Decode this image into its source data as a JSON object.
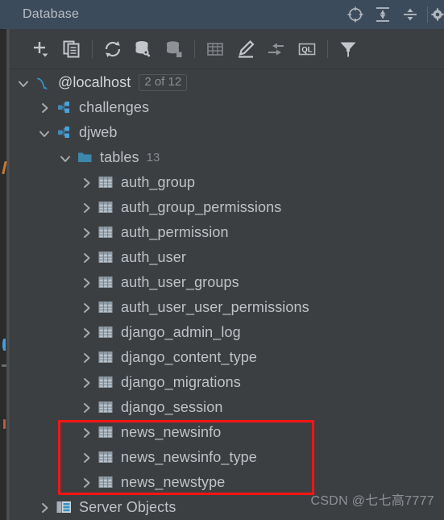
{
  "window": {
    "title": "Database"
  },
  "header": {
    "actions": [
      {
        "name": "locate-in-tree-icon",
        "label": "Scroll from Source"
      },
      {
        "name": "expand-all-icon",
        "label": "Expand All"
      },
      {
        "name": "collapse-all-icon",
        "label": "Collapse All"
      },
      {
        "name": "settings-gear-icon",
        "label": "Settings"
      }
    ]
  },
  "toolbar": {
    "buttons": [
      {
        "name": "add-new-icon",
        "label": "New"
      },
      {
        "name": "duplicate-icon",
        "label": "Duplicate"
      },
      {
        "name": "refresh-icon",
        "label": "Refresh"
      },
      {
        "name": "database-tools-icon",
        "label": "Database Tools"
      },
      {
        "name": "data-sources-icon",
        "label": "Data Sources"
      },
      {
        "name": "table-editor-icon",
        "label": "Open Table Editor"
      },
      {
        "name": "modify-icon",
        "label": "Modify Object"
      },
      {
        "name": "jump-to-icon",
        "label": "Jump to Console"
      },
      {
        "name": "query-language-icon",
        "label": "QL"
      },
      {
        "name": "filter-icon",
        "label": "Filter"
      }
    ]
  },
  "tree": {
    "nodes": [
      {
        "level": 0,
        "twisty": "expanded",
        "icon": "mysql-dolphin-icon",
        "label": "@localhost",
        "badge_box": "2 of 12"
      },
      {
        "level": 1,
        "twisty": "collapsed",
        "icon": "schema-icon",
        "label": "challenges"
      },
      {
        "level": 1,
        "twisty": "expanded",
        "icon": "schema-icon",
        "label": "djweb"
      },
      {
        "level": 2,
        "twisty": "expanded",
        "icon": "folder-icon",
        "label": "tables",
        "badge_count": "13"
      },
      {
        "level": 3,
        "twisty": "collapsed",
        "icon": "table-icon",
        "label": "auth_group"
      },
      {
        "level": 3,
        "twisty": "collapsed",
        "icon": "table-icon",
        "label": "auth_group_permissions"
      },
      {
        "level": 3,
        "twisty": "collapsed",
        "icon": "table-icon",
        "label": "auth_permission"
      },
      {
        "level": 3,
        "twisty": "collapsed",
        "icon": "table-icon",
        "label": "auth_user"
      },
      {
        "level": 3,
        "twisty": "collapsed",
        "icon": "table-icon",
        "label": "auth_user_groups"
      },
      {
        "level": 3,
        "twisty": "collapsed",
        "icon": "table-icon",
        "label": "auth_user_user_permissions"
      },
      {
        "level": 3,
        "twisty": "collapsed",
        "icon": "table-icon",
        "label": "django_admin_log"
      },
      {
        "level": 3,
        "twisty": "collapsed",
        "icon": "table-icon",
        "label": "django_content_type"
      },
      {
        "level": 3,
        "twisty": "collapsed",
        "icon": "table-icon",
        "label": "django_migrations"
      },
      {
        "level": 3,
        "twisty": "collapsed",
        "icon": "table-icon",
        "label": "django_session"
      },
      {
        "level": 3,
        "twisty": "collapsed",
        "icon": "table-icon",
        "label": "news_newsinfo"
      },
      {
        "level": 3,
        "twisty": "collapsed",
        "icon": "table-icon",
        "label": "news_newsinfo_type"
      },
      {
        "level": 3,
        "twisty": "collapsed",
        "icon": "table-icon",
        "label": "news_newstype"
      },
      {
        "level": 1,
        "twisty": "collapsed",
        "icon": "server-objects-icon",
        "label": "Server Objects"
      }
    ]
  },
  "annotation": {
    "highlight_color": "#ff1414"
  },
  "watermark": {
    "text": "CSDN @七七高7777"
  },
  "colors": {
    "header_bg": "#3c4b5c",
    "panel_bg": "#3c3f41",
    "text": "#bfc3c7",
    "accent_blue": "#3592c4",
    "icon_gray": "#aeb2b6"
  }
}
